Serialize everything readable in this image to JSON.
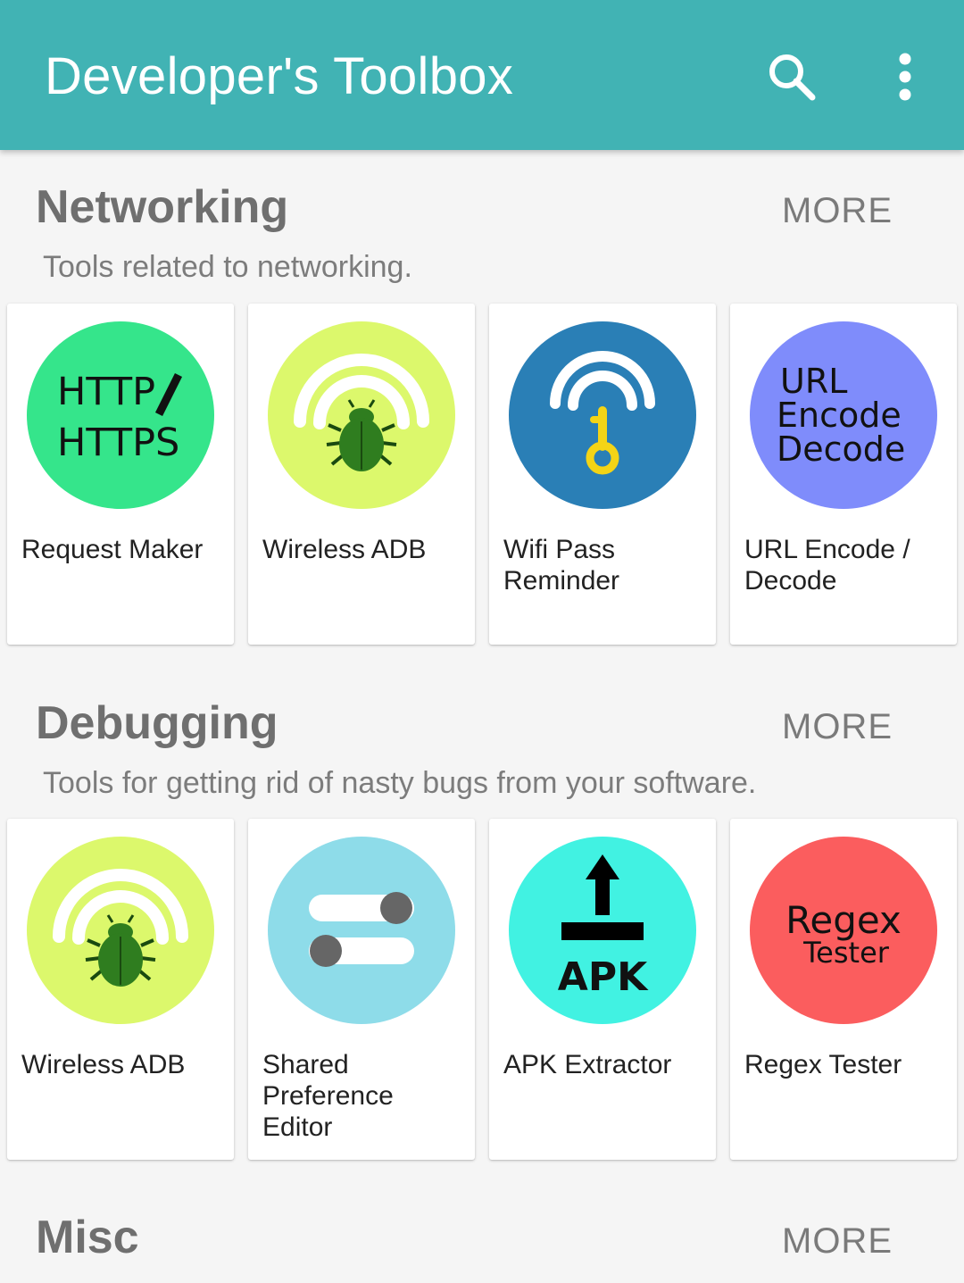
{
  "app": {
    "title": "Developer's Toolbox",
    "bar_color": "#41b3b4",
    "actions": [
      "search-icon",
      "more-vert-icon"
    ]
  },
  "sections": [
    {
      "title": "Networking",
      "more": "MORE",
      "description": "Tools related to networking.",
      "items": [
        {
          "label": "Request Maker",
          "icon": "http-https-icon",
          "icon_lines": [
            "HTTP",
            "HTTPS"
          ],
          "color": "#35e58b"
        },
        {
          "label": "Wireless ADB",
          "icon": "wireless-bug-icon",
          "color": "#dcf86c"
        },
        {
          "label": "Wifi Pass Reminder",
          "icon": "wifi-key-icon",
          "color": "#2a7fb6"
        },
        {
          "label": "URL Encode / Decode",
          "icon": "url-encode-decode-icon",
          "icon_lines": [
            "URL",
            "Encode",
            "Decode"
          ],
          "color": "#7f8cfb"
        }
      ]
    },
    {
      "title": "Debugging",
      "more": "MORE",
      "description": "Tools for getting rid of nasty bugs from your software.",
      "items": [
        {
          "label": "Wireless ADB",
          "icon": "wireless-bug-icon",
          "color": "#dcf86c"
        },
        {
          "label": "Shared Preference Editor",
          "icon": "toggle-switches-icon",
          "color": "#8edce9"
        },
        {
          "label": "APK Extractor",
          "icon": "apk-upload-icon",
          "icon_lines": [
            "APK"
          ],
          "color": "#41f2e2"
        },
        {
          "label": "Regex Tester",
          "icon": "regex-tester-icon",
          "icon_lines": [
            "Regex",
            "Tester"
          ],
          "color": "#fb5d5e"
        }
      ]
    },
    {
      "title": "Misc",
      "more": "MORE"
    }
  ]
}
